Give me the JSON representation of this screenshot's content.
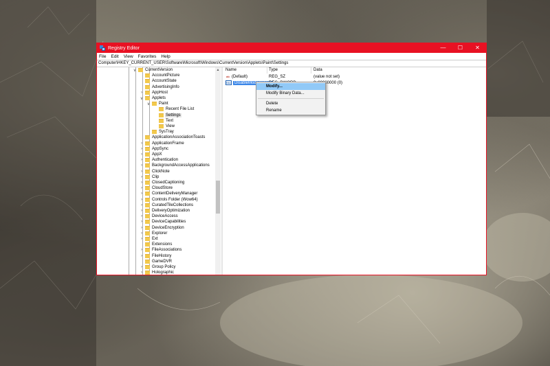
{
  "window": {
    "title": "Registry Editor",
    "minimize": "—",
    "maximize": "☐",
    "close": "✕"
  },
  "menubar": [
    "File",
    "Edit",
    "View",
    "Favorites",
    "Help"
  ],
  "address": "Computer\\HKEY_CURRENT_USER\\Software\\Microsoft\\Windows\\CurrentVersion\\Applets\\Paint\\Settings",
  "tree": {
    "nodes": [
      {
        "label": "CurrentVersion",
        "expander": "∨"
      },
      {
        "label": "AccountPicture",
        "expander": ""
      },
      {
        "label": "AccountState",
        "expander": ""
      },
      {
        "label": "AdvertisingInfo",
        "expander": ""
      },
      {
        "label": "AppHost",
        "expander": "›"
      },
      {
        "label": "Applets",
        "expander": "∨"
      },
      {
        "label": "Paint",
        "expander": "∨"
      },
      {
        "label": "Recent File List",
        "expander": ""
      },
      {
        "label": "Settings",
        "expander": ""
      },
      {
        "label": "Text",
        "expander": ""
      },
      {
        "label": "View",
        "expander": ""
      },
      {
        "label": "SysTray",
        "expander": ""
      },
      {
        "label": "ApplicationAssociationToasts",
        "expander": ""
      },
      {
        "label": "ApplicationFrame",
        "expander": "›"
      },
      {
        "label": "AppSync",
        "expander": "›"
      },
      {
        "label": "AppX",
        "expander": "›"
      },
      {
        "label": "Authentication",
        "expander": "›"
      },
      {
        "label": "BackgroundAccessApplications",
        "expander": "›"
      },
      {
        "label": "ClickNote",
        "expander": "›"
      },
      {
        "label": "Clip",
        "expander": "›"
      },
      {
        "label": "ClosedCaptioning",
        "expander": "›"
      },
      {
        "label": "CloudStore",
        "expander": "›"
      },
      {
        "label": "ContentDeliveryManager",
        "expander": "›"
      },
      {
        "label": "Controls Folder (Wow64)",
        "expander": "›"
      },
      {
        "label": "CuratedTileCollections",
        "expander": "›"
      },
      {
        "label": "DeliveryOptimization",
        "expander": "›"
      },
      {
        "label": "DeviceAccess",
        "expander": "›"
      },
      {
        "label": "DeviceCapabilities",
        "expander": "›"
      },
      {
        "label": "DeviceEncryption",
        "expander": "›"
      },
      {
        "label": "Explorer",
        "expander": "›"
      },
      {
        "label": "Ext",
        "expander": "›"
      },
      {
        "label": "Extensions",
        "expander": ""
      },
      {
        "label": "FileAssociations",
        "expander": "›"
      },
      {
        "label": "FileHistory",
        "expander": "›"
      },
      {
        "label": "GameDVR",
        "expander": ""
      },
      {
        "label": "Group Policy",
        "expander": "›"
      },
      {
        "label": "Holographic",
        "expander": "›"
      }
    ]
  },
  "values": {
    "columns": [
      "Name",
      "Type",
      "Data"
    ],
    "rows": [
      {
        "name": "(Default)",
        "type": "REG_SZ",
        "data": "(value not set)",
        "icon": "ab"
      },
      {
        "name": "DisableModernPaint",
        "type": "REG_DWORD",
        "data": "0x00000000 (0)",
        "icon": "011"
      }
    ]
  },
  "context_menu": {
    "items": [
      "Modify...",
      "Modify Binary Data...",
      "Delete",
      "Rename"
    ]
  },
  "colors": {
    "accent": "#e81123",
    "selection": "#3b86e8",
    "menu_highlight": "#91c9f7"
  }
}
